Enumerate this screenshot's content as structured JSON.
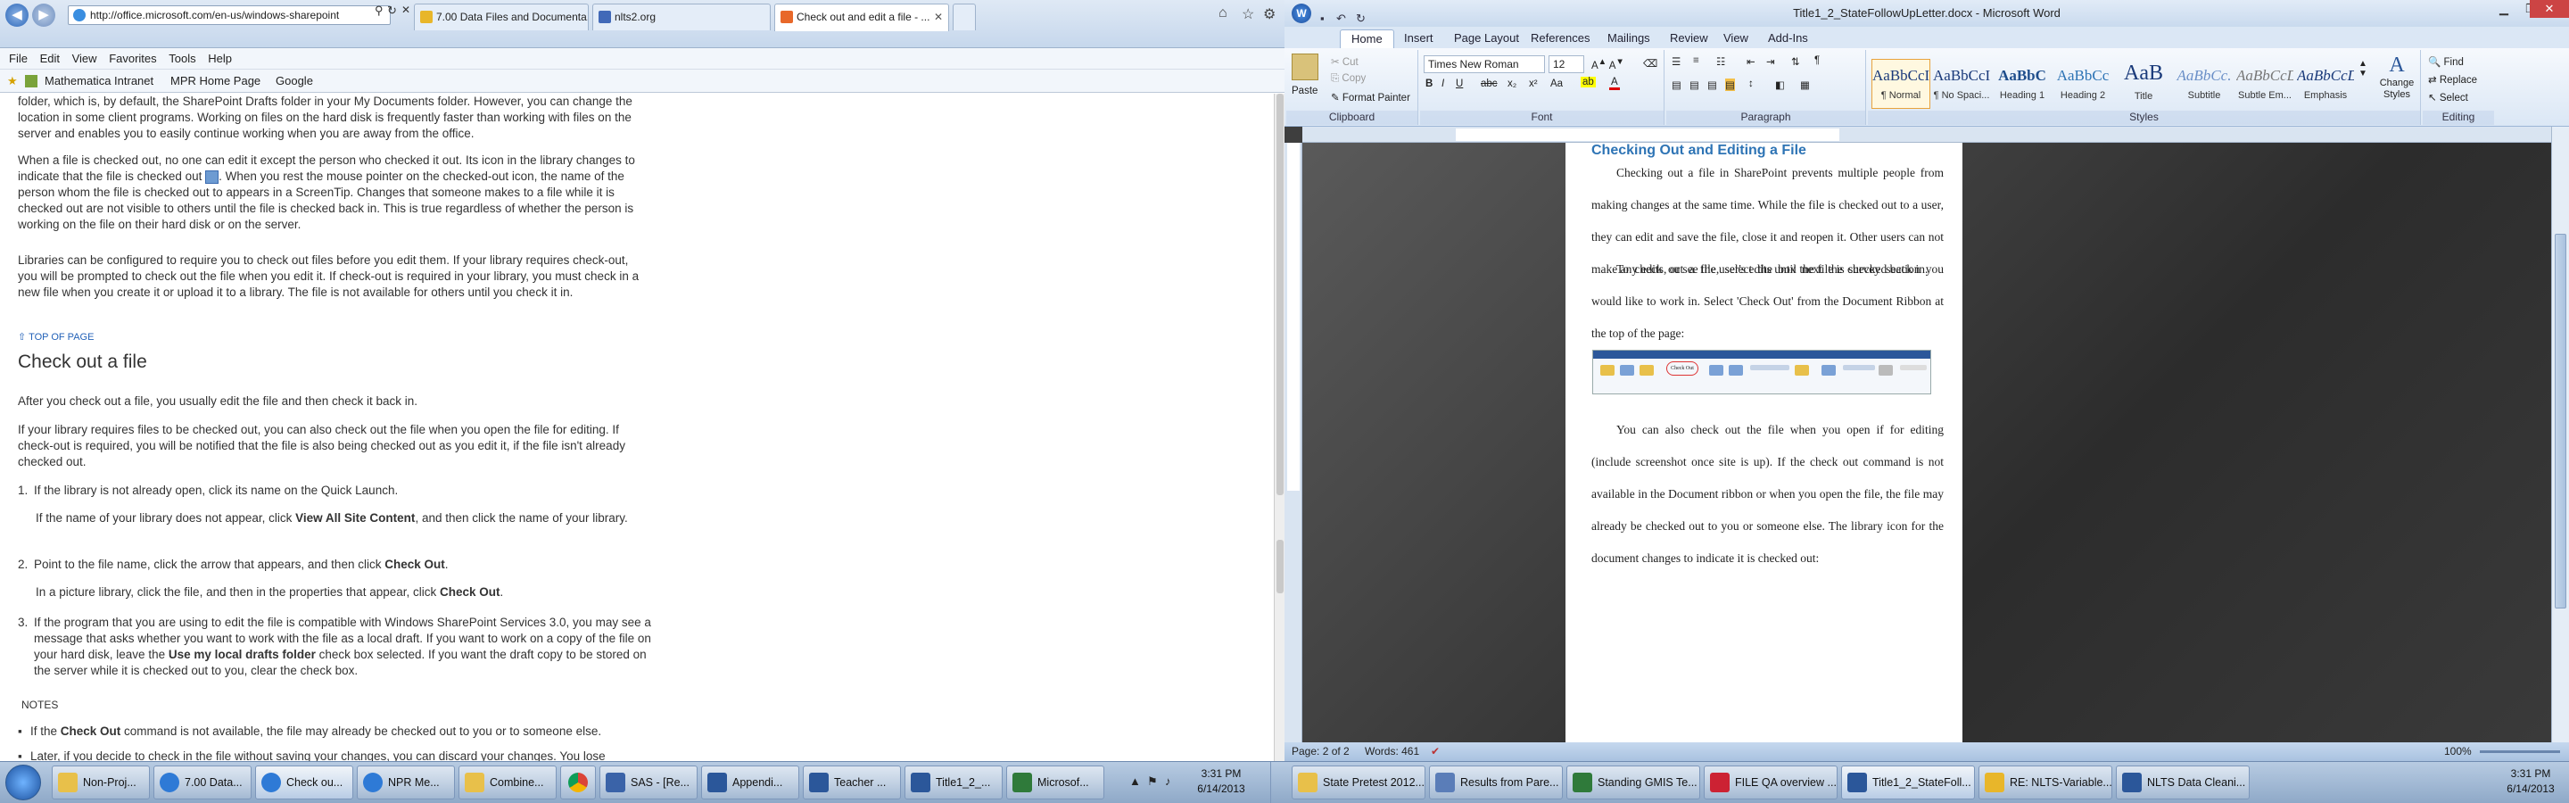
{
  "ie": {
    "address": "http://office.microsoft.com/en-us/windows-sharepoint",
    "tabs": [
      {
        "label": "7.00 Data Files and Documenta..."
      },
      {
        "label": "nlts2.org"
      },
      {
        "label": "Check out and edit a file - ..."
      }
    ],
    "menu": [
      "File",
      "Edit",
      "View",
      "Favorites",
      "Tools",
      "Help"
    ],
    "favorites": [
      "Mathematica Intranet",
      "MPR Home Page",
      "Google"
    ],
    "article": {
      "p1": "folder, which is, by default, the SharePoint Drafts folder in your My Documents folder. However, you can change the location in some client programs. Working on files on the hard disk is frequently faster than working with files on the server and enables you to easily continue working when you are away from the office.",
      "p2a": "When a file is checked out, no one can edit it except the person who checked it out. Its icon in the library changes to indicate that the file is checked out",
      "p2b": ". When you rest the mouse pointer on the checked-out icon, the name of the person whom the file is checked out to appears in a ScreenTip. Changes that someone makes to a file while it is checked out are not visible to others until the file is checked back in. This is true regardless of whether the person is working on the file on their hard disk or on the server.",
      "p3": "Libraries can be configured to require you to check out files before you edit them. If your library requires check-out, you will be prompted to check out the file when you edit it. If check-out is required in your library, you must check in a new file when you create it or upload it to a library. The file is not available for others until you check it in.",
      "top_link": "TOP OF PAGE",
      "heading": "Check out a file",
      "p4": "After you check out a file, you usually edit the file and then check it back in.",
      "p5": "If your library requires files to be checked out, you can also check out the file when you open the file for editing. If check-out is required, you will be notified that the file is also being checked out as you edit it, if the file isn't already checked out.",
      "step1": "If the library is not already open, click its name on the Quick Launch.",
      "step1_sub_a": "If the name of your library does not appear, click ",
      "step1_sub_b": "View All Site Content",
      "step1_sub_c": ", and then click the name of your library.",
      "step2_a": "Point to the file name, click the arrow that appears, and then click ",
      "step2_b": "Check Out",
      "step2_sub_a": "In a picture library, click the file, and then in the properties that appear, click ",
      "step2_sub_b": "Check Out",
      "step3_a": "If the program that you are using to edit the file is compatible with Windows SharePoint Services 3.0, you may see a message that asks whether you want to work with the file as a local draft. If you want to work on a copy of the file on your hard disk, leave the ",
      "step3_b": "Use my local drafts folder",
      "step3_c": " check box selected. If you want the draft copy to be stored on the server while it is checked out to you, clear the check box.",
      "notes": "NOTES",
      "note1_a": "If the ",
      "note1_b": "Check Out",
      "note1_c": " command is not available, the file may already be checked out to you or to someone else.",
      "note2": "Later, if you decide to check in the file without saving your changes, you can discard your changes. You lose"
    }
  },
  "left_taskbar": {
    "buttons": [
      "Non-Proj...",
      "7.00 Data...",
      "Check ou...",
      "NPR Me...",
      "Combine...",
      "",
      "SAS - [Re...",
      "Appendi...",
      "Teacher ...",
      "Title1_2_...",
      "Microsof..."
    ],
    "time": "3:31 PM",
    "date": "6/14/2013"
  },
  "word": {
    "title": "Title1_2_StateFollowUpLetter.docx - Microsoft Word",
    "tabs": [
      "Home",
      "Insert",
      "Page Layout",
      "References",
      "Mailings",
      "Review",
      "View",
      "Add-Ins"
    ],
    "clipboard": {
      "paste": "Paste",
      "cut": "Cut",
      "copy": "Copy",
      "format_painter": "Format Painter",
      "label": "Clipboard"
    },
    "font": {
      "name": "Times New Roman",
      "size": "12",
      "label": "Font"
    },
    "paragraph_label": "Paragraph",
    "styles": [
      {
        "preview": "AaBbCcI",
        "name": "¶ Normal"
      },
      {
        "preview": "AaBbCcI",
        "name": "¶ No Spaci..."
      },
      {
        "preview": "AaBbC",
        "name": "Heading 1"
      },
      {
        "preview": "AaBbCc",
        "name": "Heading 2"
      },
      {
        "preview": "AaB",
        "name": "Title"
      },
      {
        "preview": "AaBbCc.",
        "name": "Subtitle"
      },
      {
        "preview": "AaBbCcD",
        "name": "Subtle Em..."
      },
      {
        "preview": "AaBbCcD",
        "name": "Emphasis"
      }
    ],
    "styles_label": "Styles",
    "change_styles": "Change Styles",
    "editing": {
      "find": "Find",
      "replace": "Replace",
      "select": "Select",
      "label": "Editing"
    },
    "doc": {
      "heading": "Checking Out and Editing a File",
      "p1": "Checking out a file in SharePoint prevents multiple people from making changes at the same time. While the file is checked out to a user, they can edit and save the file, close it and reopen it. Other users can not make any edits, or see the user's edits until the file is checked back in.",
      "p2": "To check out a file, select the box next the survey section you would like to work in. Select 'Check Out' from the Document Ribbon at the top of the page:",
      "shot_label": "Check Out",
      "p3": "You can also check out the file when you open if for editing (include screenshot once site is up). If the check out command is not available in the Document ribbon or when you open the file, the file may already be checked out to you or someone else. The library icon for the document changes to indicate it is checked out:"
    },
    "status": {
      "page": "Page: 2 of 2",
      "words": "Words: 461",
      "zoom": "100%"
    }
  },
  "right_taskbar": {
    "buttons": [
      "State Pretest 2012...",
      "Results from Pare...",
      "Standing GMIS Te...",
      "FILE QA overview ...",
      "Title1_2_StateFoll...",
      "RE: NLTS-Variable...",
      "NLTS Data Cleani..."
    ],
    "time": "3:31 PM",
    "date": "6/14/2013"
  }
}
